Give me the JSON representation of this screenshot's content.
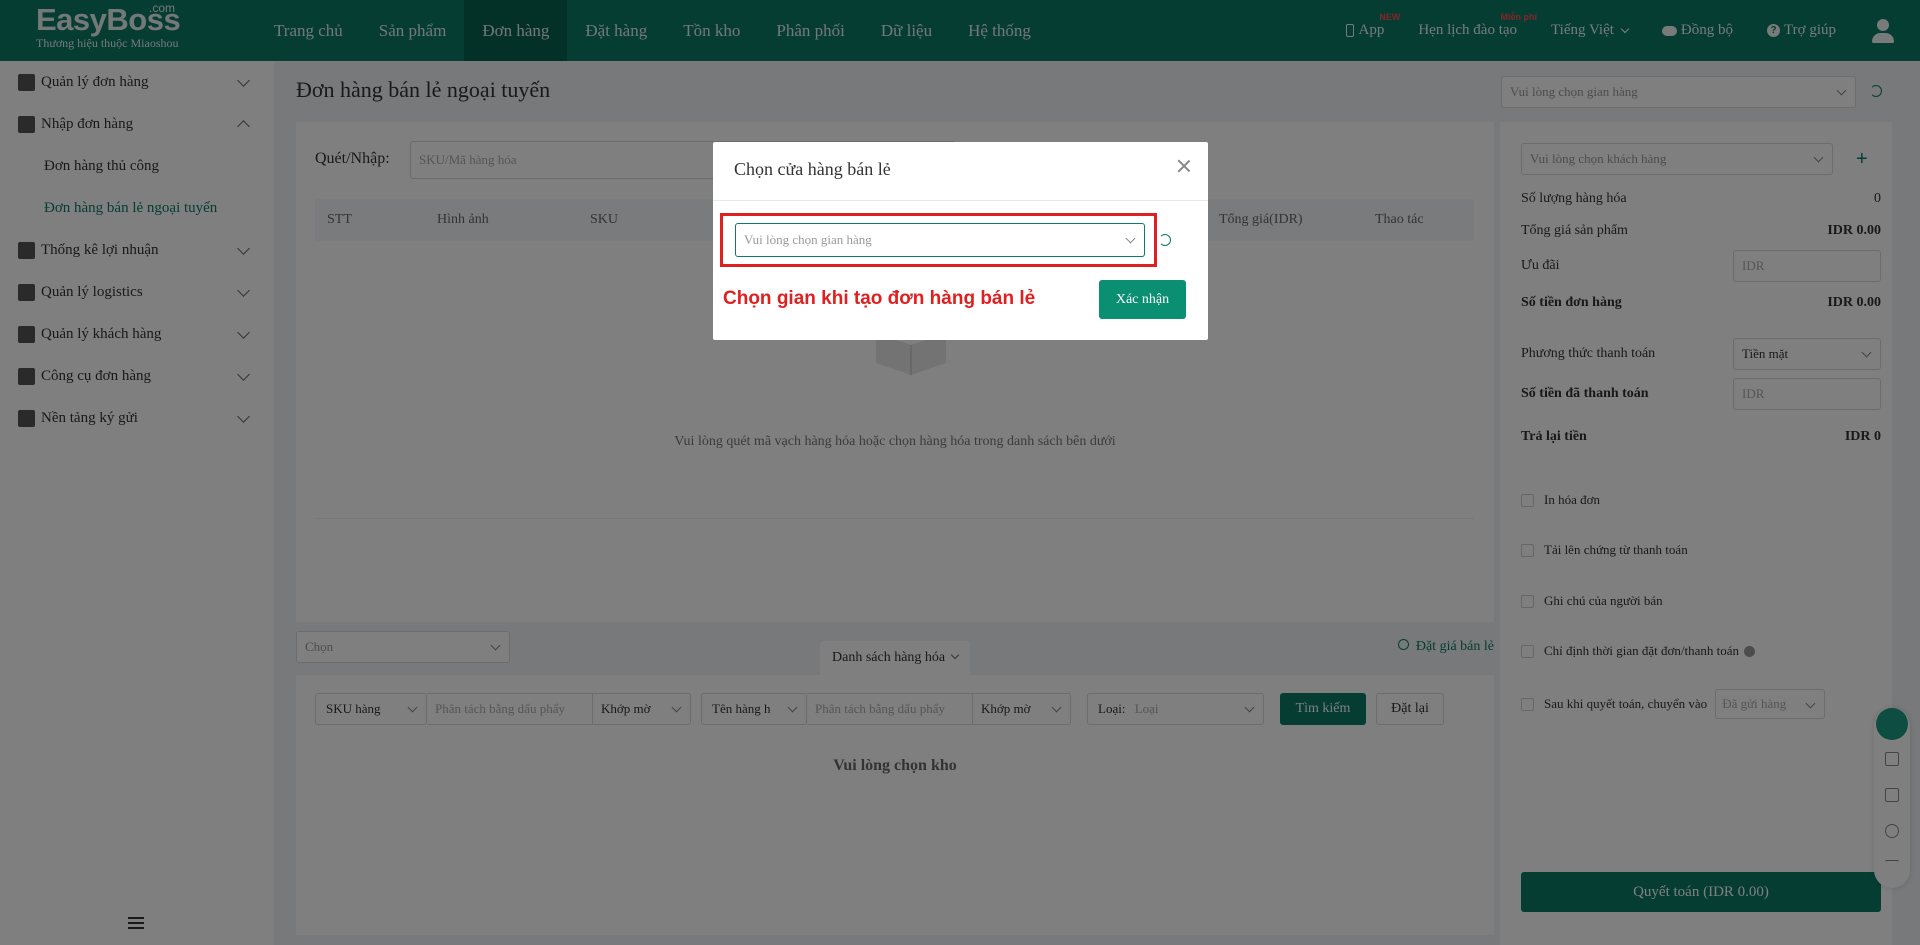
{
  "logo": {
    "main": "EasyBoss",
    "com": ".com",
    "sub": "Thương hiệu thuộc Miaoshou"
  },
  "nav": {
    "items": [
      "Trang chủ",
      "Sản phẩm",
      "Đơn hàng",
      "Đặt hàng",
      "Tồn kho",
      "Phân phối",
      "Dữ liệu",
      "Hệ thống"
    ],
    "active_index": 2
  },
  "nav_right": {
    "app": "App",
    "app_badge": "NEW",
    "training": "Hẹn lịch đào tạo",
    "training_badge": "Miễn phí",
    "language": "Tiếng Việt",
    "sync": "Đồng bộ",
    "help": "Trợ giúp"
  },
  "sidebar": {
    "items": [
      {
        "label": "Quản lý đơn hàng"
      },
      {
        "label": "Nhập đơn hàng"
      },
      {
        "label": "Thống kê lợi nhuận"
      },
      {
        "label": "Quản lý logistics"
      },
      {
        "label": "Quản lý khách hàng"
      },
      {
        "label": "Công cụ đơn hàng"
      },
      {
        "label": "Nền tảng ký gửi"
      }
    ],
    "sub_items": [
      "Đơn hàng thủ công",
      "Đơn hàng bán lẻ ngoại tuyến"
    ]
  },
  "main": {
    "title": "Đơn hàng bán lẻ ngoại tuyến",
    "scan_label": "Quét/Nhập:",
    "scan_placeholder": "SKU/Mã hàng hóa",
    "columns": [
      "STT",
      "Hình ảnh",
      "SKU",
      "Tổng giá(IDR)",
      "Thao tác"
    ],
    "empty_text": "Vui lòng quét mã vạch hàng hóa hoặc chọn hàng hóa trong danh sách bên dưới",
    "chon_select": "Chọn",
    "product_tab": "Danh sách hàng hóa",
    "set_price": "Đặt giá bán lẻ",
    "filters": {
      "sku_type": "SKU hàng",
      "sku_placeholder": "Phân tách bằng dấu phẩy",
      "match1": "Khớp mờ",
      "name_type": "Tên hàng h",
      "name_placeholder": "Phân tách bằng dấu phẩy",
      "match2": "Khớp mờ",
      "type_label": "Loại:",
      "type_placeholder": "Loại",
      "search": "Tìm kiếm",
      "reset": "Đặt lại"
    },
    "choose_warehouse": "Vui lòng chọn kho"
  },
  "right": {
    "store_placeholder": "Vui lòng chọn gian hàng",
    "customer_placeholder": "Vui lòng chọn khách hàng",
    "qty_label": "Số lượng hàng hóa",
    "qty_value": "0",
    "total_label": "Tổng giá sản phẩm",
    "total_value": "IDR 0.00",
    "discount_label": "Ưu đãi",
    "discount_input": "IDR",
    "order_amount_label": "Số tiền đơn hàng",
    "order_amount_value": "IDR 0.00",
    "payment_label": "Phương thức thanh toán",
    "payment_value": "Tiền mặt",
    "paid_label": "Số tiền đã thanh toán",
    "paid_input": "IDR",
    "change_label": "Trả lại tiền",
    "change_value": "IDR 0",
    "checks": [
      "In hóa đơn",
      "Tải lên chứng từ thanh toán",
      "Ghi chú của người bán",
      "Chỉ định thời gian đặt đơn/thanh toán",
      "Sau khi quyết toán, chuyển vào"
    ],
    "after_select": "Đã gửi hàng",
    "checkout": "Quyết toán (IDR 0.00)"
  },
  "modal": {
    "title": "Chọn cửa hàng bán lẻ",
    "select_placeholder": "Vui lòng chọn gian hàng",
    "note": "Chọn gian khi tạo đơn hàng bán lẻ",
    "confirm": "Xác nhận"
  },
  "colors": {
    "primary": "#0b7a66",
    "annotation": "#e02020"
  }
}
